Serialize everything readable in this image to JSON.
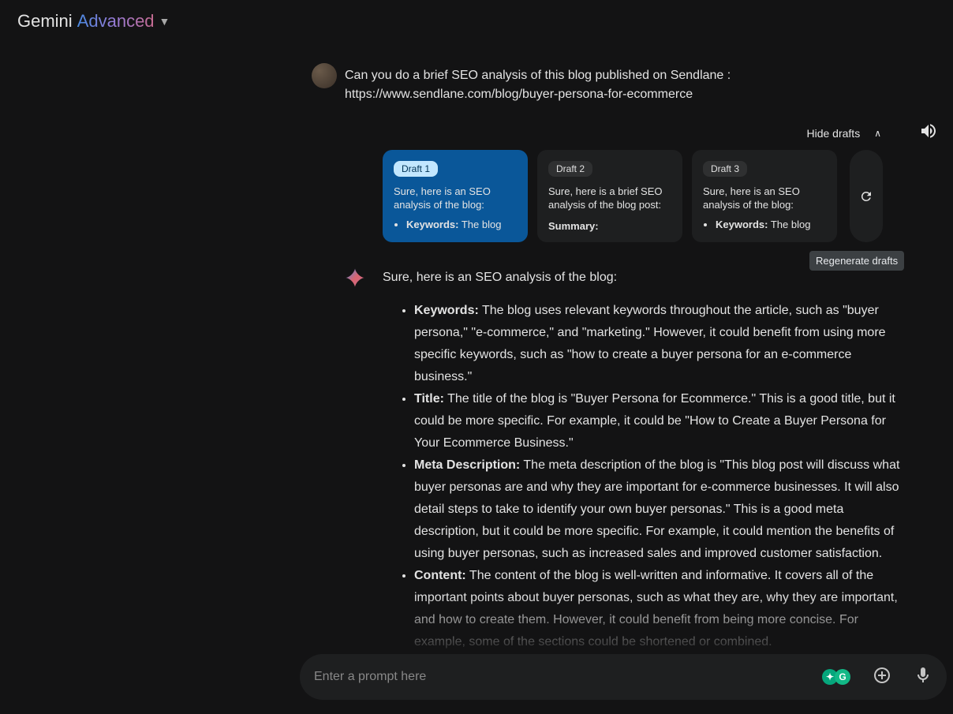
{
  "header": {
    "brand": "Gemini",
    "tier": "Advanced"
  },
  "user": {
    "message": "Can you do a brief SEO analysis of this blog published on Sendlane : https://www.sendlane.com/blog/buyer-persona-for-ecommerce"
  },
  "drafts": {
    "toggle_label": "Hide drafts",
    "regenerate_tooltip": "Regenerate drafts",
    "cards": [
      {
        "label": "Draft 1",
        "active": true,
        "preview_intro": "Sure, here is an SEO analysis of the blog:",
        "bullet_label": "Keywords:",
        "bullet_rest": " The blog"
      },
      {
        "label": "Draft 2",
        "active": false,
        "preview_intro": "Sure, here is a brief SEO analysis of the blog post:",
        "summary_label": "Summary:"
      },
      {
        "label": "Draft 3",
        "active": false,
        "preview_intro": "Sure, here is an SEO analysis of the blog:",
        "bullet_label": "Keywords:",
        "bullet_rest": " The blog"
      }
    ]
  },
  "answer": {
    "intro": "Sure, here is an SEO analysis of the blog:",
    "items": [
      {
        "label": "Keywords:",
        "text": " The blog uses relevant keywords throughout the article, such as \"buyer persona,\" \"e-commerce,\" and \"marketing.\" However, it could benefit from using more specific keywords, such as \"how to create a buyer persona for an e-commerce business.\""
      },
      {
        "label": "Title:",
        "text": " The title of the blog is \"Buyer Persona for Ecommerce.\" This is a good title, but it could be more specific. For example, it could be \"How to Create a Buyer Persona for Your Ecommerce Business.\""
      },
      {
        "label": "Meta Description:",
        "text": " The meta description of the blog is \"This blog post will discuss what buyer personas are and why they are important for e-commerce businesses. It will also detail steps to take to identify your own buyer personas.\" This is a good meta description, but it could be more specific. For example, it could mention the benefits of using buyer personas, such as increased sales and improved customer satisfaction."
      },
      {
        "label": "Content:",
        "text": " The content of the blog is well-written and informative. It covers all of the important points about buyer personas, such as what they are, why they are important, and how to create them. However, it could benefit from being more concise. For example, some of the sections could be shortened or combined."
      }
    ]
  },
  "composer": {
    "placeholder": "Enter a prompt here"
  }
}
